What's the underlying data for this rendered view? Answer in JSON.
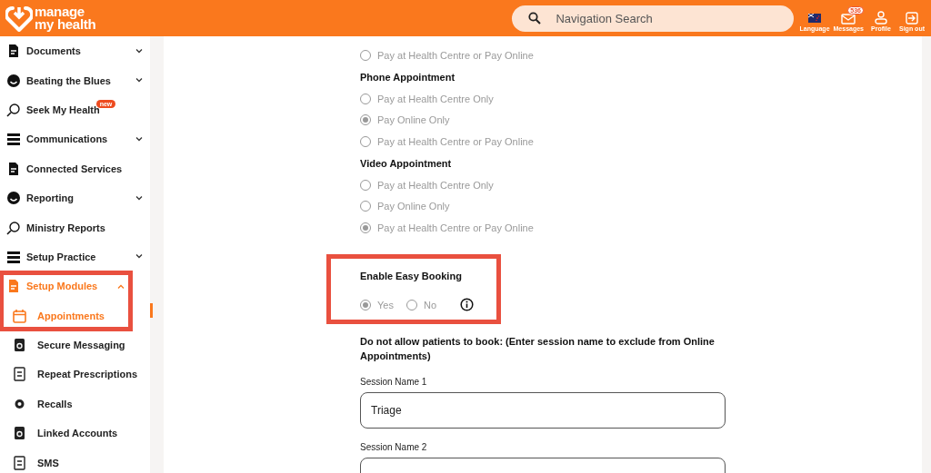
{
  "header": {
    "logo": [
      "manage",
      "my health"
    ],
    "search": {
      "placeholder": "Navigation Search"
    },
    "actions": [
      {
        "kind": "language",
        "label": "Language"
      },
      {
        "kind": "messages",
        "label": "Messages",
        "badge": "536"
      },
      {
        "kind": "profile",
        "label": "Profile"
      },
      {
        "kind": "signout",
        "label": "Sign out"
      }
    ]
  },
  "sidebar": {
    "items": [
      {
        "label": "Documents",
        "expanded": false,
        "selected": false
      },
      {
        "label": "Beating the Blues",
        "expanded": false,
        "selected": false
      },
      {
        "label": "Seek My Health",
        "badge": "new",
        "selected": false
      },
      {
        "label": "Communications",
        "expanded": false,
        "selected": false
      },
      {
        "label": "Connected Services",
        "selected": false
      },
      {
        "label": "Reporting",
        "expanded": false,
        "selected": false
      },
      {
        "label": "Ministry Reports",
        "selected": false
      },
      {
        "label": "Setup Practice",
        "expanded": false,
        "selected": false
      },
      {
        "label": "Setup Modules",
        "expanded": true,
        "selected": true,
        "highlighted": true,
        "children": [
          {
            "label": "Appointments",
            "selected": true
          },
          {
            "label": "Secure Messaging",
            "selected": false
          },
          {
            "label": "Repeat Prescriptions",
            "selected": false
          },
          {
            "label": "Recalls",
            "selected": false
          },
          {
            "label": "Linked Accounts",
            "selected": false
          },
          {
            "label": "SMS",
            "selected": false
          }
        ]
      }
    ]
  },
  "payment_groups": [
    {
      "options": [
        {
          "label": "Pay at Health Centre or Pay Online",
          "selected": false
        }
      ]
    },
    {
      "title": "Phone Appointment",
      "options": [
        {
          "label": "Pay at Health Centre Only",
          "selected": false
        },
        {
          "label": "Pay Online Only",
          "selected": true
        },
        {
          "label": "Pay at Health Centre or Pay Online",
          "selected": false
        }
      ]
    },
    {
      "title": "Video Appointment",
      "options": [
        {
          "label": "Pay at Health Centre Only",
          "selected": false
        },
        {
          "label": "Pay Online Only",
          "selected": false
        },
        {
          "label": "Pay at Health Centre or Pay Online",
          "selected": true
        }
      ]
    }
  ],
  "easy_booking": {
    "title": "Enable Easy Booking",
    "highlighted": true,
    "options": [
      {
        "label": "Yes",
        "selected": true
      },
      {
        "label": "No",
        "selected": false
      }
    ]
  },
  "exclusion": {
    "title": "Do not allow patients to book: (Enter session name to exclude from Online Appointments)",
    "sessions": [
      {
        "label": "Session Name 1",
        "value": "Triage"
      },
      {
        "label": "Session Name 2"
      }
    ]
  }
}
